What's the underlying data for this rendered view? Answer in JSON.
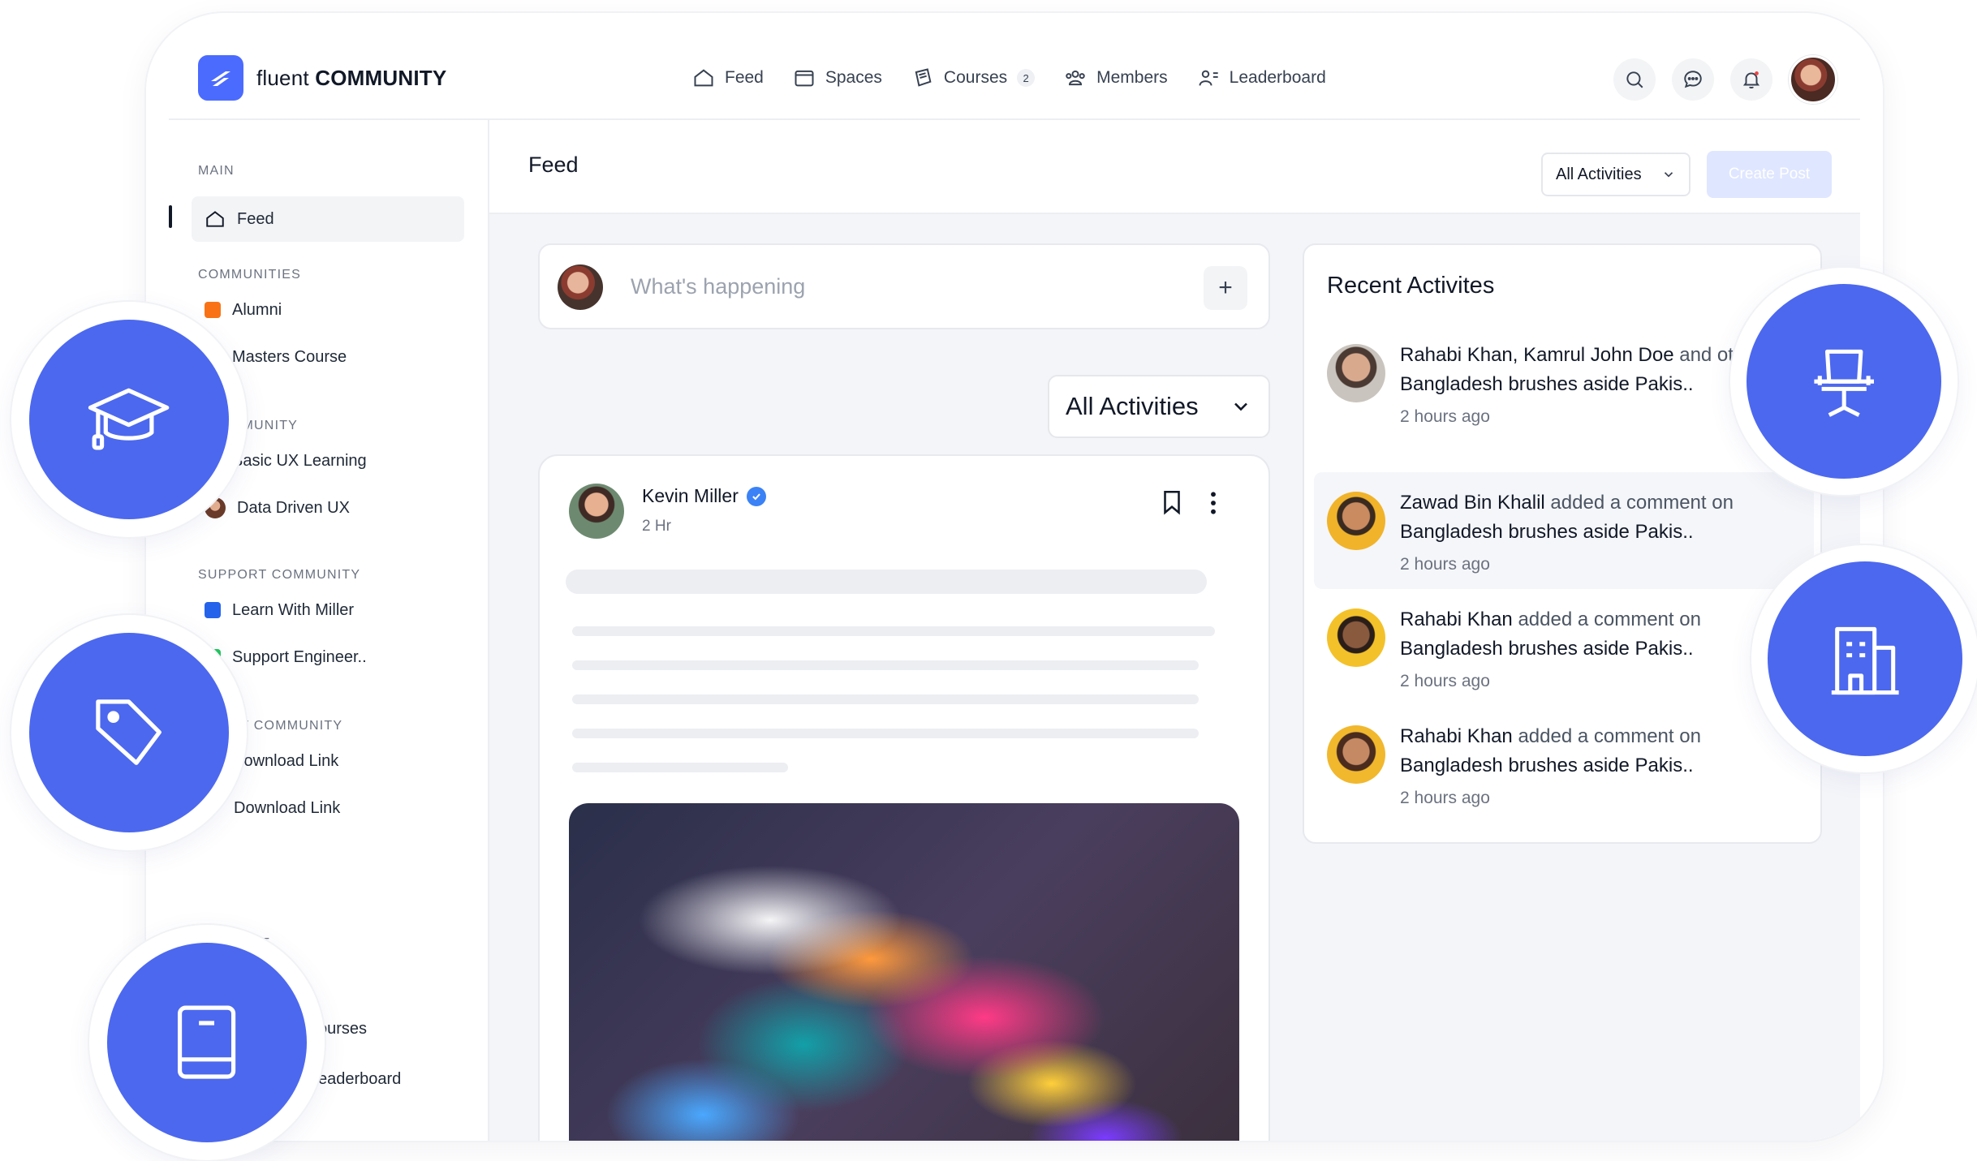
{
  "brand": {
    "name_light": "fluent",
    "name_bold": "COMMUNITY"
  },
  "nav": [
    {
      "label": "Feed",
      "icon": "home-icon"
    },
    {
      "label": "Spaces",
      "icon": "spaces-icon"
    },
    {
      "label": "Courses",
      "icon": "courses-icon",
      "badge": "2"
    },
    {
      "label": "Members",
      "icon": "members-icon"
    },
    {
      "label": "Leaderboard",
      "icon": "leaderboard-icon"
    }
  ],
  "sidebar": {
    "main_heading": "MAIN",
    "feed_label": "Feed",
    "communities_heading": "COMMUNITIES",
    "communities": [
      {
        "label": "Alumni",
        "color": "#f97316"
      },
      {
        "label": "Masters Course",
        "color": "#6366f1"
      }
    ],
    "community_heading": "MMUNITY",
    "community_items": [
      {
        "label": "Basic UX Learning"
      },
      {
        "label": "Data Driven UX"
      }
    ],
    "support_heading": "SUPPORT COMMUNITY",
    "support_items": [
      {
        "label": "Learn With Miller",
        "color": "#2563eb"
      },
      {
        "label": "Support Engineer..",
        "color": "#22c55e"
      }
    ],
    "support_heading_2": "RT COMMUNITY",
    "links": [
      {
        "label": "Download Link"
      },
      {
        "label": "Download Link"
      }
    ],
    "page_heading": "GE",
    "page_items": [
      {
        "label": "ourses"
      },
      {
        "label": "eaderboard"
      }
    ]
  },
  "content": {
    "title": "Feed",
    "filter_small": "All Activities",
    "create_button": "Create Post",
    "composer_placeholder": "What's happening",
    "composer_add": "+",
    "filter_large": "All Activities"
  },
  "post": {
    "author": "Kevin Miller",
    "time": "2 Hr"
  },
  "recent": {
    "title": "Recent Activites",
    "items": [
      {
        "actor": "Rahabi Khan, Kamrul John Doe",
        "rest": " and others people added a comment on",
        "target": "Bangladesh brushes aside Pakis..",
        "time": "2 hours ago"
      },
      {
        "actor": "Zawad Bin Khalil",
        "rest": " added a comment on",
        "target": "Bangladesh brushes aside Pakis..",
        "time": "2 hours ago"
      },
      {
        "actor": "Rahabi Khan",
        "rest": " added a comment on",
        "target": "Bangladesh brushes aside Pakis..",
        "time": "2 hours ago"
      },
      {
        "actor": "Rahabi Khan",
        "rest": " added a comment on",
        "target": "Bangladesh brushes aside Pakis..",
        "time": "2 hours ago"
      }
    ]
  },
  "colors": {
    "accent": "#4c68ef",
    "brand": "#4b6bff",
    "create_disabled": "#dfe6ff"
  },
  "floating_icons": [
    "graduation-cap-icon",
    "tag-icon",
    "book-icon",
    "office-chair-icon",
    "building-icon"
  ]
}
